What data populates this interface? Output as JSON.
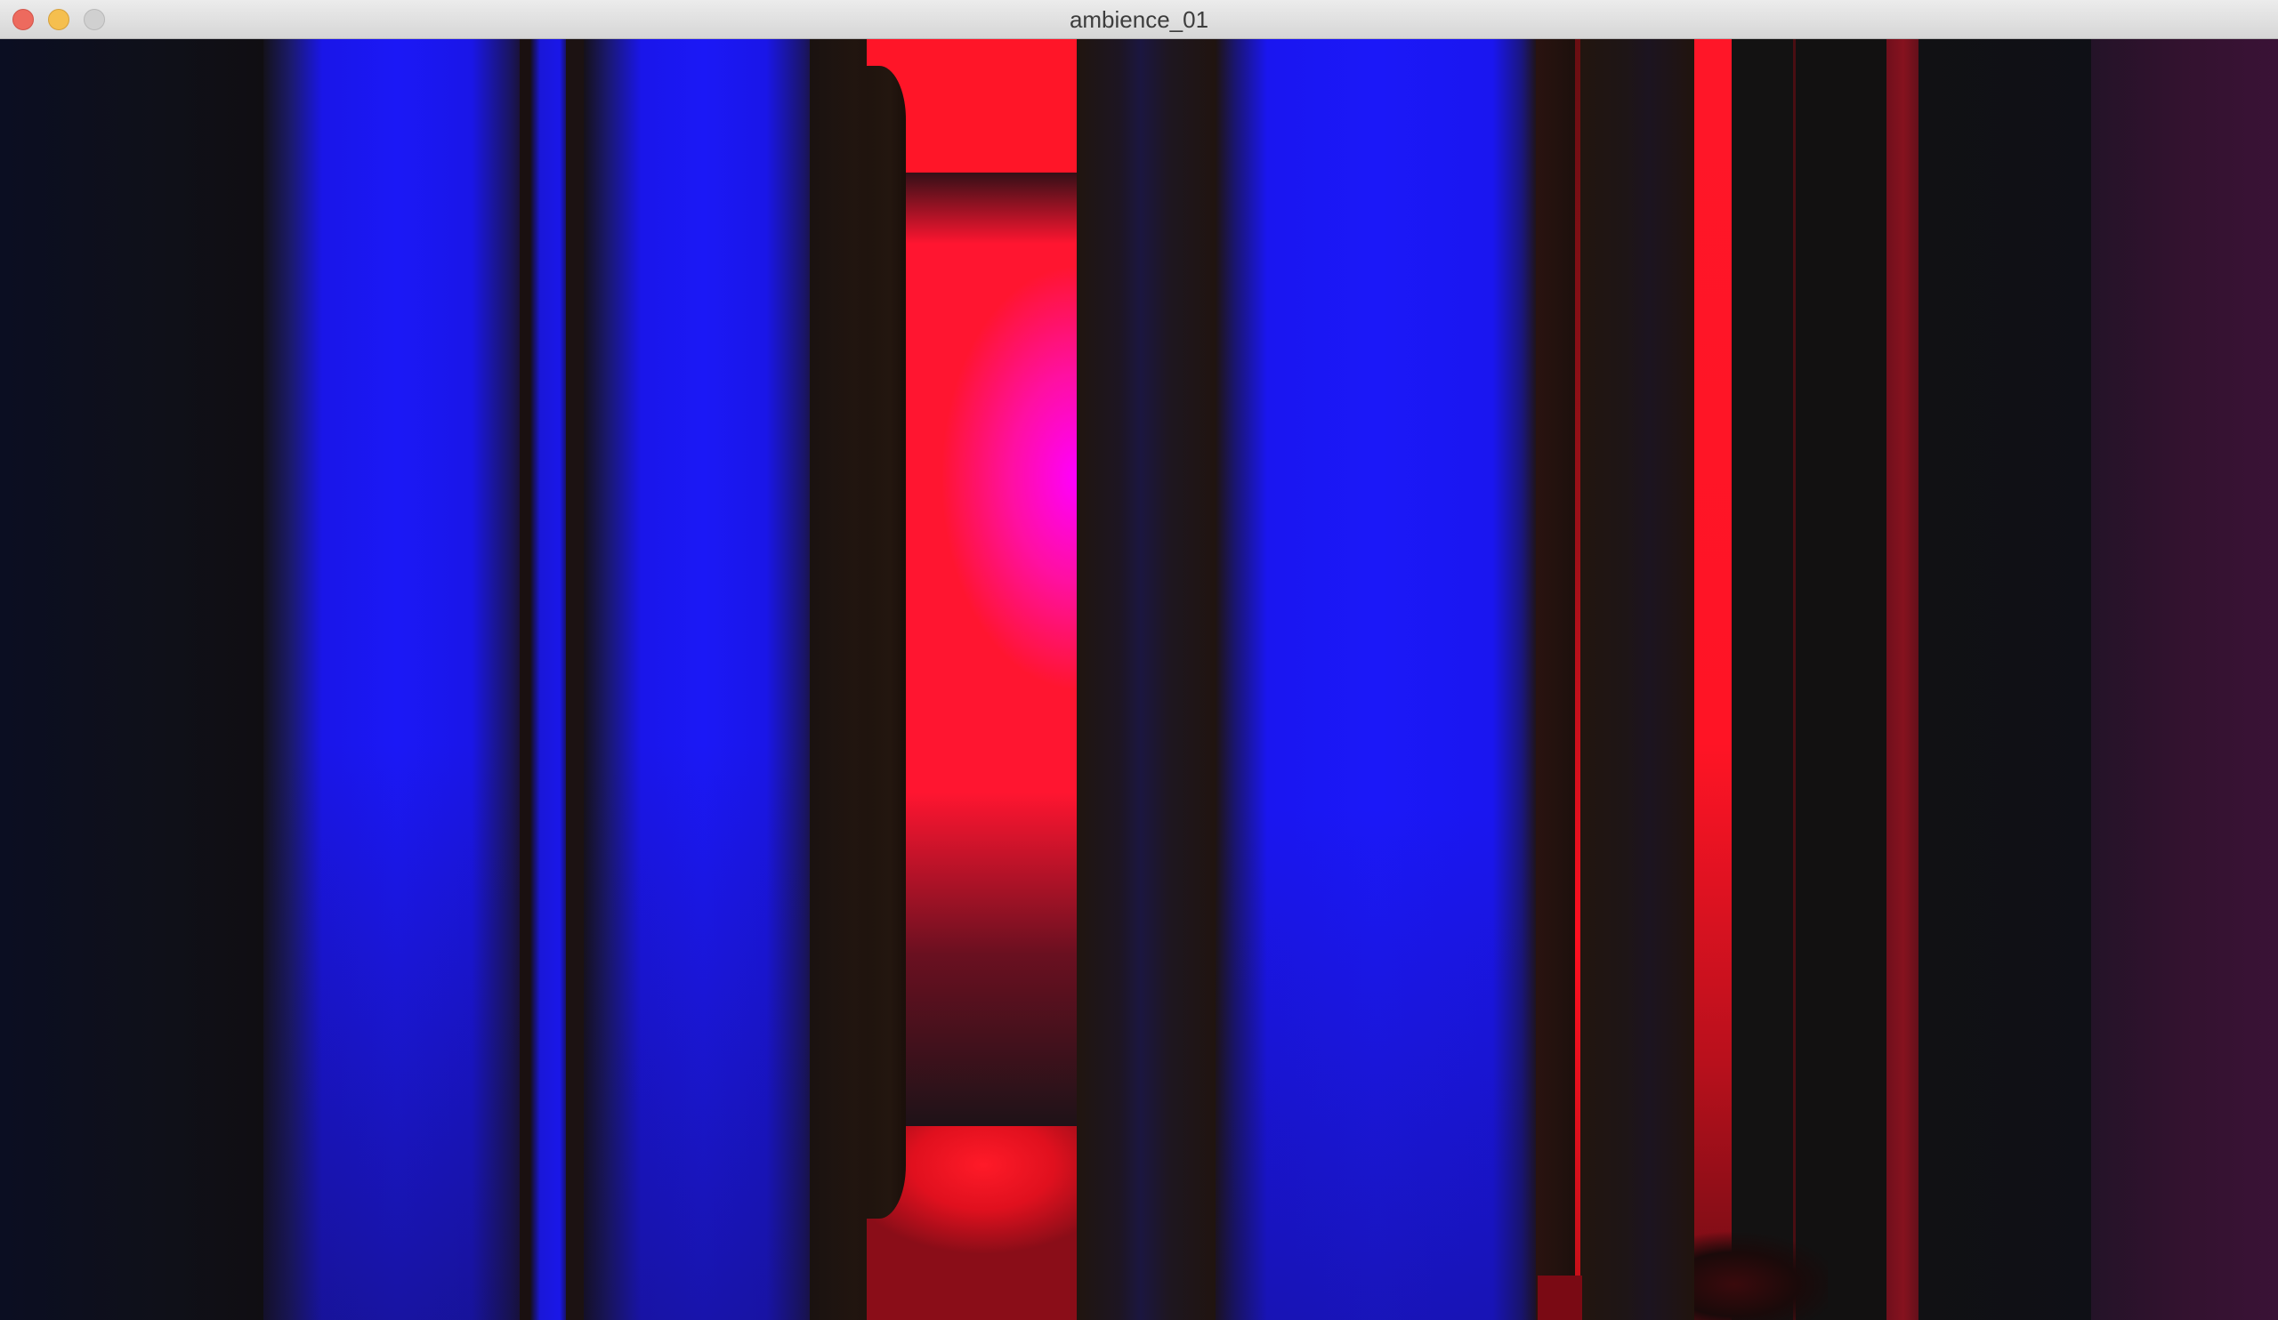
{
  "window": {
    "title": "ambience_01"
  },
  "titlebar": {
    "buttons": [
      "close",
      "minimize",
      "zoom"
    ]
  },
  "scene": {
    "description_colors": {
      "blue": "#1b18f6",
      "red": "#ff1528",
      "magenta": "#ff00ff",
      "dark": "#1a1210",
      "purple": "#33122f"
    }
  }
}
